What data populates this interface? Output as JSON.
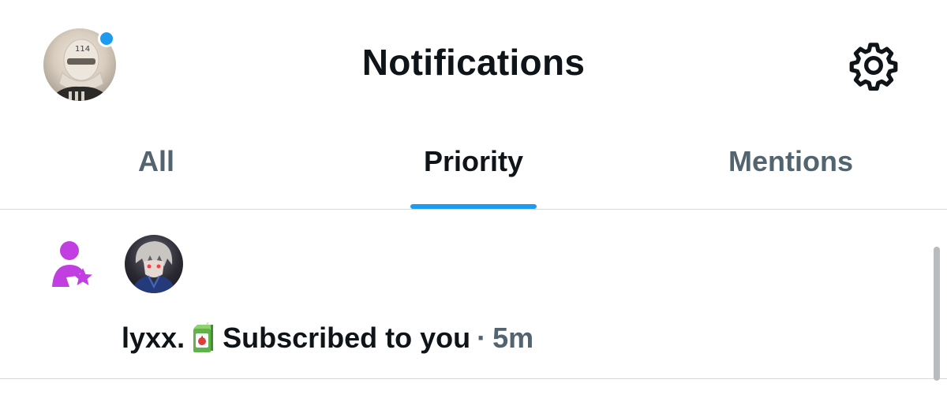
{
  "header": {
    "title": "Notifications",
    "profile_icon": "profile-avatar",
    "settings_icon": "gear-icon",
    "unread_dot_color": "#1d9bf0"
  },
  "tabs": [
    {
      "label": "All",
      "active": false
    },
    {
      "label": "Priority",
      "active": true
    },
    {
      "label": "Mentions",
      "active": false
    }
  ],
  "notifications": [
    {
      "type_icon": "person-star-icon",
      "type_icon_color": "#c13fe0",
      "actor_name": "lyxx.",
      "actor_emoji": "juice-box-emoji",
      "action": "Subscribed to you",
      "separator": "·",
      "time": "5m"
    }
  ],
  "colors": {
    "accent": "#1d9bf0",
    "text_primary": "#0f1419",
    "text_secondary": "#536471",
    "subscribe_purple": "#c13fe0"
  }
}
